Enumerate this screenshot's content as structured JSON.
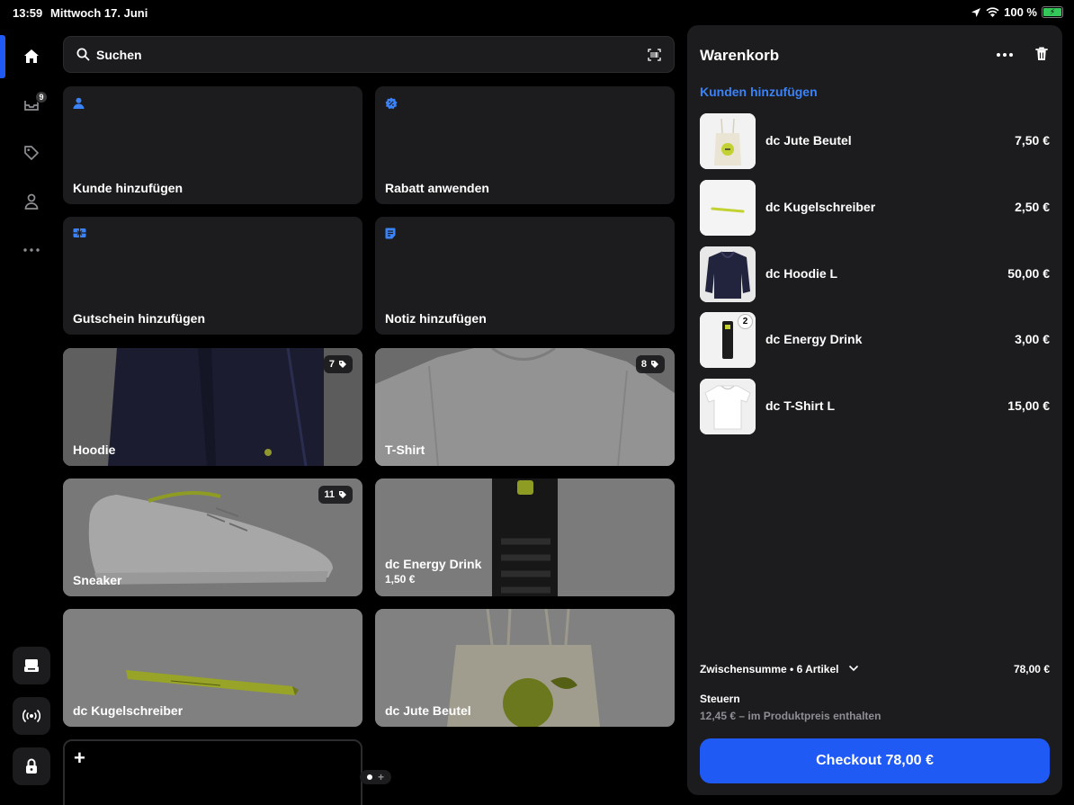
{
  "status_bar": {
    "time": "13:59",
    "date": "Mittwoch 17. Juni",
    "battery": "100 %"
  },
  "rail": {
    "inbox_badge": "9"
  },
  "search": {
    "placeholder": "Suchen"
  },
  "tiles": {
    "customer": "Kunde hinzufügen",
    "discount": "Rabatt anwenden",
    "voucher": "Gutschein hinzufügen",
    "note": "Notiz hinzufügen",
    "hoodie": {
      "label": "Hoodie",
      "count": "7"
    },
    "tshirt": {
      "label": "T-Shirt",
      "count": "8"
    },
    "sneaker": {
      "label": "Sneaker",
      "count": "11"
    },
    "energy": {
      "label": "dc Energy Drink",
      "price": "1,50 €"
    },
    "pen": {
      "label": "dc Kugelschreiber"
    },
    "bag": {
      "label": "dc Jute Beutel"
    }
  },
  "cart": {
    "title": "Warenkorb",
    "add_customer": "Kunden hinzufügen",
    "items": [
      {
        "name": "dc Jute Beutel",
        "price": "7,50 €"
      },
      {
        "name": "dc Kugelschreiber",
        "price": "2,50 €"
      },
      {
        "name": "dc Hoodie L",
        "price": "50,00 €"
      },
      {
        "name": "dc Energy Drink",
        "price": "3,00 €",
        "qty": "2"
      },
      {
        "name": "dc T-Shirt L",
        "price": "15,00 €"
      }
    ],
    "subtotal_label": "Zwischensumme • 6 Artikel",
    "subtotal_value": "78,00 €",
    "tax_label": "Steuern",
    "tax_note": "12,45 € – im Produktpreis enthalten",
    "checkout_label": "Checkout 78,00 €"
  },
  "colors": {
    "accent": "#1f5af5",
    "link": "#3b82f6",
    "panel": "#1c1c1e"
  }
}
